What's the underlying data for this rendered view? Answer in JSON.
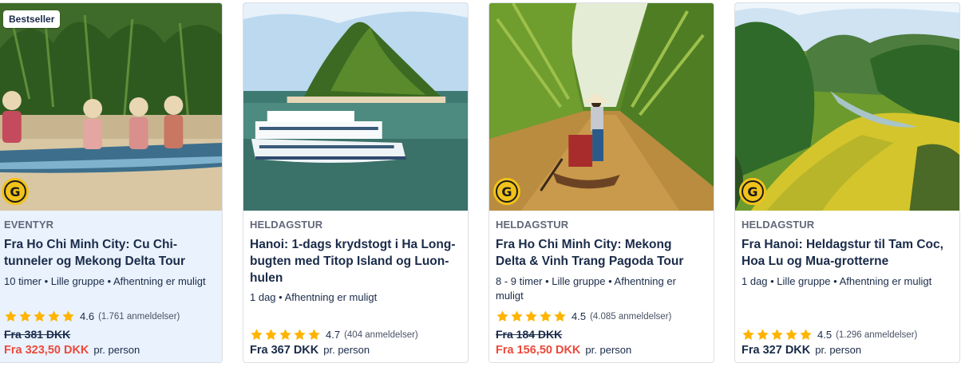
{
  "colors": {
    "sale_price": "#eb4a3b",
    "star": "#ffb400",
    "highlight_bg": "#e9f2fd",
    "text": "#1a2b49"
  },
  "cards": [
    {
      "badge": "Bestseller",
      "logo_letter": "G",
      "category": "EVENTYR",
      "title": "Fra Ho Chi Minh City: Cu Chi-tunneler og Mekong Delta Tour",
      "meta": "10 timer • Lille gruppe • Afhentning er muligt",
      "rating_value": "4.6",
      "rating_count": "(1.761 anmeldelser)",
      "stars": 5,
      "old_price": "Fra 381 DKK",
      "price": "Fra 323,50 DKK",
      "per": "pr. person",
      "image_icon": "boat-river-photo"
    },
    {
      "badge": "",
      "logo_letter": "",
      "category": "HELDAGSTUR",
      "title": "Hanoi: 1-dags krydstogt i Ha Long-bugten med Titop Island og Luon-hulen",
      "meta": "1 dag • Afhentning er muligt",
      "rating_value": "4.7",
      "rating_count": "(404 anmeldelser)",
      "stars": 5,
      "old_price": "",
      "price": "Fra 367 DKK",
      "per": "pr. person",
      "image_icon": "cruise-ship-photo"
    },
    {
      "badge": "",
      "logo_letter": "G",
      "category": "HELDAGSTUR",
      "title": "Fra Ho Chi Minh City: Mekong Delta & Vinh Trang Pagoda Tour",
      "meta": "8 - 9 timer • Lille gruppe • Afhentning er muligt",
      "rating_value": "4.5",
      "rating_count": "(4.085 anmeldelser)",
      "stars": 5,
      "old_price": "Fra 184 DKK",
      "price": "Fra 156,50 DKK",
      "per": "pr. person",
      "image_icon": "mekong-canal-photo"
    },
    {
      "badge": "",
      "logo_letter": "G",
      "category": "HELDAGSTUR",
      "title": "Fra Hanoi: Heldagstur til Tam Coc, Hoa Lu og Mua-grotterne",
      "meta": "1 dag • Lille gruppe • Afhentning er muligt",
      "rating_value": "4.5",
      "rating_count": "(1.296 anmeldelser)",
      "stars": 5,
      "old_price": "",
      "price": "Fra 327 DKK",
      "per": "pr. person",
      "image_icon": "rice-field-photo"
    }
  ]
}
